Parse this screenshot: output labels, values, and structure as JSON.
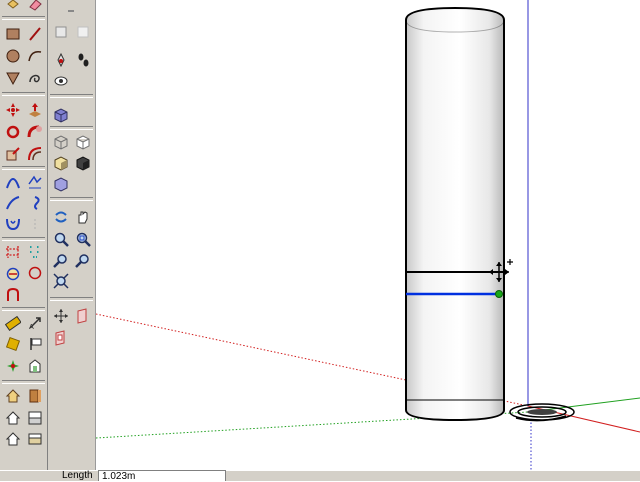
{
  "status_bar": {
    "length_label": "Length",
    "length_value": "1.023m"
  },
  "toolbar_left": {
    "icons": [
      "make-component-icon",
      "eraser-icon",
      "rectangle-icon",
      "line-icon",
      "circle-icon",
      "arc-icon",
      "polygon-icon",
      "freehand-icon",
      "move-icon",
      "push-pull-icon",
      "rotate-icon",
      "follow-me-icon",
      "scale-icon",
      "offset-icon",
      "sandbox-smoove-icon",
      "sandbox-from-contours-icon",
      "sandbox-stamp-icon",
      "sandbox-drape-icon",
      "sandbox-add-detail-icon",
      "sandbox-flip-edge-icon",
      "intersect-icon",
      "sandbox-grid-icon",
      "tape-measure-icon",
      "protractor-icon",
      "axes-icon",
      "dimension-icon",
      "text-icon",
      "section-plane-icon",
      "warehouse-get-models-icon",
      "warehouse-share-model-icon",
      "home-icon",
      "save-icon",
      "home-outline-icon",
      "component-browser-icon"
    ]
  },
  "toolbar_mid": {
    "icons": [
      "select-arrow-icon",
      "shaded-cube-icon",
      "paint-bucket-icon",
      "footprints-icon",
      "look-around-icon",
      "iso-view-icon",
      "wireframe-icon",
      "hidden-line-icon",
      "shaded-icon",
      "monochrome-icon",
      "xray-icon",
      "orbit-icon",
      "pan-hand-icon",
      "zoom-icon",
      "zoom-window-icon",
      "previous-view-icon",
      "next-view-icon",
      "zoom-extents-icon",
      "position-camera-icon",
      "section-display-icon",
      "section-cut-icon"
    ]
  },
  "colors": {
    "toolbar_bg": "#d4d0c8",
    "red_axis": "#d22020",
    "green_axis": "#20a020",
    "blue_axis": "#3030c8",
    "inference_blue": "#0030e0",
    "endpoint_green": "#18a818"
  }
}
